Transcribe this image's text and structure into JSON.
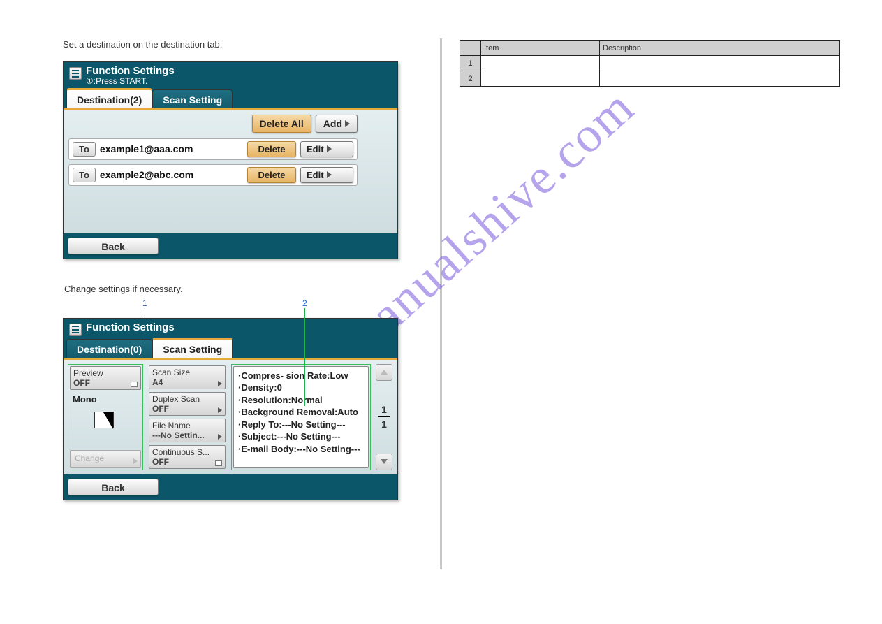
{
  "intro_text": "Set a destination on the destination tab.",
  "panel1": {
    "title": "Function Settings",
    "subtitle": "①:Press START.",
    "tabs": {
      "destination": "Destination(2)",
      "scan": "Scan Setting"
    },
    "actions": {
      "delete_all": "Delete All",
      "add": "Add"
    },
    "rows": [
      {
        "to": "To",
        "email": "example1@aaa.com",
        "delete": "Delete",
        "edit": "Edit"
      },
      {
        "to": "To",
        "email": "example2@abc.com",
        "delete": "Delete",
        "edit": "Edit"
      }
    ],
    "back": "Back"
  },
  "step_text": "Change settings if necessary.",
  "callouts": {
    "n1": "1",
    "n2": "2"
  },
  "panel2": {
    "title": "Function Settings",
    "tabs": {
      "destination": "Destination(0)",
      "scan": "Scan Setting"
    },
    "left": {
      "preview_label": "Preview",
      "preview_val": "OFF",
      "mono_label": "Mono",
      "change_label": "Change"
    },
    "mid": {
      "scan_size_label": "Scan Size",
      "scan_size_val": "A4",
      "duplex_label": "Duplex Scan",
      "duplex_val": "OFF",
      "filename_label": "File Name",
      "filename_val": "---No Settin...",
      "cont_label": "Continuous S...",
      "cont_val": "OFF"
    },
    "info_lines": [
      "·Compres- sion Rate:Low",
      "·Density:0",
      "·Resolution:Normal",
      "·Background Removal:Auto",
      "·Reply To:---No Setting---",
      "·Subject:---No Setting---",
      "·E-mail Body:---No Setting---"
    ],
    "page_current": "1",
    "page_total": "1",
    "back": "Back"
  },
  "table": {
    "headers": {
      "c0": "",
      "c1": "Item",
      "c2": "Description"
    },
    "rows": [
      {
        "n": "1",
        "item": "",
        "desc": ""
      },
      {
        "n": "2",
        "item": "",
        "desc": ""
      }
    ]
  },
  "watermark": "manualshive.com"
}
